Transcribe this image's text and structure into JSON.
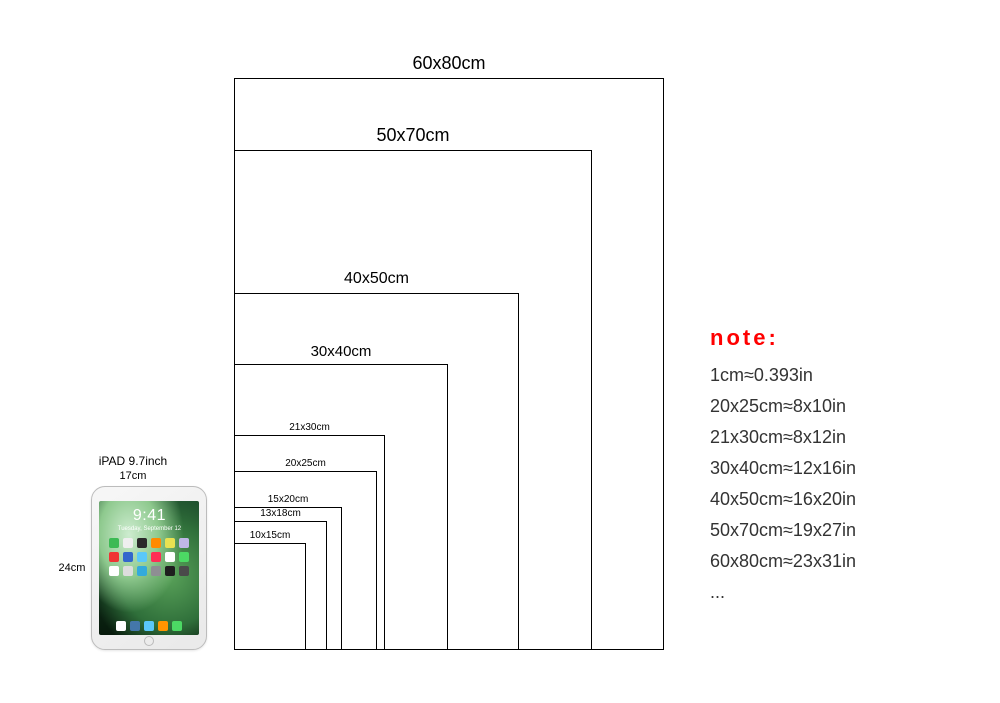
{
  "ipad": {
    "title": "iPAD 9.7inch",
    "width_label": "17cm",
    "height_label": "24cm",
    "clock": "9:41",
    "date": "Tuesday, September 12"
  },
  "frames": [
    {
      "key": "60x80",
      "label": "60x80cm"
    },
    {
      "key": "50x70",
      "label": "50x70cm"
    },
    {
      "key": "40x50",
      "label": "40x50cm"
    },
    {
      "key": "30x40",
      "label": "30x40cm"
    },
    {
      "key": "21x30",
      "label": "21x30cm"
    },
    {
      "key": "20x25",
      "label": "20x25cm"
    },
    {
      "key": "15x20",
      "label": "15x20cm"
    },
    {
      "key": "13x18",
      "label": "13x18cm"
    },
    {
      "key": "10x15",
      "label": "10x15cm"
    }
  ],
  "note": {
    "title": "note:",
    "lines": [
      "1cm≈0.393in",
      "20x25cm≈8x10in",
      "21x30cm≈8x12in",
      "30x40cm≈12x16in",
      "40x50cm≈16x20in",
      "50x70cm≈19x27in",
      "60x80cm≈23x31in",
      "..."
    ]
  },
  "chart_data": {
    "type": "table",
    "title": "Print size comparison with conversion to inches",
    "reference_object": {
      "name": "iPAD 9.7inch",
      "width_cm": 17,
      "height_cm": 24
    },
    "sizes_cm": [
      {
        "w": 10,
        "h": 15
      },
      {
        "w": 13,
        "h": 18
      },
      {
        "w": 15,
        "h": 20
      },
      {
        "w": 20,
        "h": 25
      },
      {
        "w": 21,
        "h": 30
      },
      {
        "w": 30,
        "h": 40
      },
      {
        "w": 40,
        "h": 50
      },
      {
        "w": 50,
        "h": 70
      },
      {
        "w": 60,
        "h": 80
      }
    ],
    "conversion_factor_cm_to_in": 0.393,
    "conversions": [
      {
        "cm": "20x25",
        "in": "8x10"
      },
      {
        "cm": "21x30",
        "in": "8x12"
      },
      {
        "cm": "30x40",
        "in": "12x16"
      },
      {
        "cm": "40x50",
        "in": "16x20"
      },
      {
        "cm": "50x70",
        "in": "19x27"
      },
      {
        "cm": "60x80",
        "in": "23x31"
      }
    ]
  }
}
